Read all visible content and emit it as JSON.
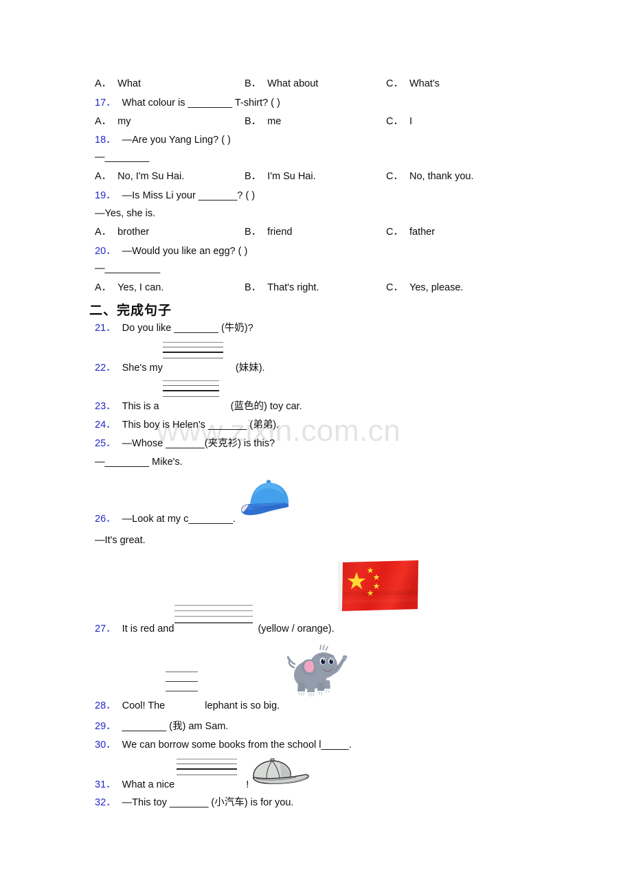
{
  "document": {
    "watermark": "www.zixin.com.cn",
    "accent_blue": "#2526cf",
    "rule_gray": "#6b6b6b",
    "watermark_color": "#e4e4e4"
  },
  "carryover_options": {
    "a": "A．",
    "a_text": "What",
    "b": "B．",
    "b_text": "What about",
    "c": "C．",
    "c_text": "What's"
  },
  "multiple_choice": [
    {
      "number": "17．",
      "stem": "What colour is ________ T-shirt? (    )",
      "options": [
        {
          "label": "A．",
          "text": "my"
        },
        {
          "label": "B．",
          "text": "me"
        },
        {
          "label": "C．",
          "text": "I"
        }
      ]
    },
    {
      "number": "18．",
      "stem": "—Are you Yang Ling? (    )",
      "stem2": "—________",
      "options": [
        {
          "label": "A．",
          "text": "No, I'm Su Hai."
        },
        {
          "label": "B．",
          "text": "I'm Su Hai."
        },
        {
          "label": "C．",
          "text": "No, thank you."
        }
      ]
    },
    {
      "number": "19．",
      "stem": "—Is Miss Li your _______? (  )",
      "stem2": "—Yes, she is.",
      "options": [
        {
          "label": "A．",
          "text": "brother"
        },
        {
          "label": "B．",
          "text": "friend"
        },
        {
          "label": "C．",
          "text": "father"
        }
      ]
    },
    {
      "number": "20．",
      "stem": "—Would you like an egg? (    )",
      "stem2": "—__________",
      "options": [
        {
          "label": "A．",
          "text": "Yes, I can."
        },
        {
          "label": "B．",
          "text": "That's right."
        },
        {
          "label": "C．",
          "text": "Yes, please."
        }
      ]
    }
  ],
  "section_two": {
    "heading": "二、完成句子",
    "items": [
      {
        "number": "21．",
        "text": "Do you like ________ (牛奶)?"
      },
      {
        "number": "22．",
        "text": "She's my",
        "tail": "(妹妹)."
      },
      {
        "number": "23．",
        "text": "This is a",
        "tail": "(蓝色的) toy car."
      },
      {
        "number": "24．",
        "text": "This boy is Helen's _______ (弟弟)."
      },
      {
        "number": "25．",
        "text": "—Whose _______(夹克衫) is this?",
        "text2": "—________ Mike's."
      },
      {
        "number": "26．",
        "text": "—Look at my c________.",
        "text2": "—It's great."
      },
      {
        "number": "27．",
        "text": "It is red and",
        "tail": "(yellow / orange)."
      },
      {
        "number": "28．",
        "text": "Cool! The",
        "tail": "lephant is so big."
      },
      {
        "number": "29．",
        "text": "________ (我) am Sam."
      },
      {
        "number": "30．",
        "text": "We can borrow some books from the school l_____."
      },
      {
        "number": "31．",
        "text": "What a nice",
        "tail": "!"
      },
      {
        "number": "32．",
        "text": "—This toy _______ (小汽车) is for you."
      }
    ]
  },
  "illustrations": [
    {
      "name": "blue-baseball-cap",
      "for_question": "26．"
    },
    {
      "name": "flag-of-china",
      "for_question": "27．"
    },
    {
      "name": "cartoon-elephant",
      "for_question": "28．"
    },
    {
      "name": "gray-baseball-cap",
      "for_question": "31．"
    }
  ]
}
